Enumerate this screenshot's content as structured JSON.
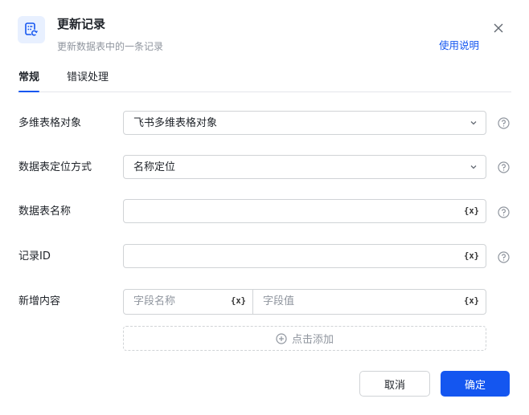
{
  "dialog": {
    "title": "更新记录",
    "subtitle": "更新数据表中的一条记录",
    "help_link": "使用说明",
    "icon": "table-refresh-icon"
  },
  "tabs": [
    {
      "label": "常规",
      "active": true
    },
    {
      "label": "错误处理",
      "active": false
    }
  ],
  "fields": {
    "table_object": {
      "label": "多维表格对象",
      "value": "飞书多维表格对象"
    },
    "locate_method": {
      "label": "数据表定位方式",
      "value": "名称定位"
    },
    "table_name": {
      "label": "数据表名称",
      "value": ""
    },
    "record_id": {
      "label": "记录ID",
      "value": ""
    },
    "new_content": {
      "label": "新增内容",
      "key_placeholder": "字段名称",
      "value_placeholder": "字段值",
      "add_label": "点击添加"
    }
  },
  "var_button_label": "{x}",
  "buttons": {
    "cancel": "取消",
    "confirm": "确定"
  },
  "colors": {
    "accent": "#1456f0",
    "border": "#d0d3d6",
    "muted": "#8f959e"
  }
}
